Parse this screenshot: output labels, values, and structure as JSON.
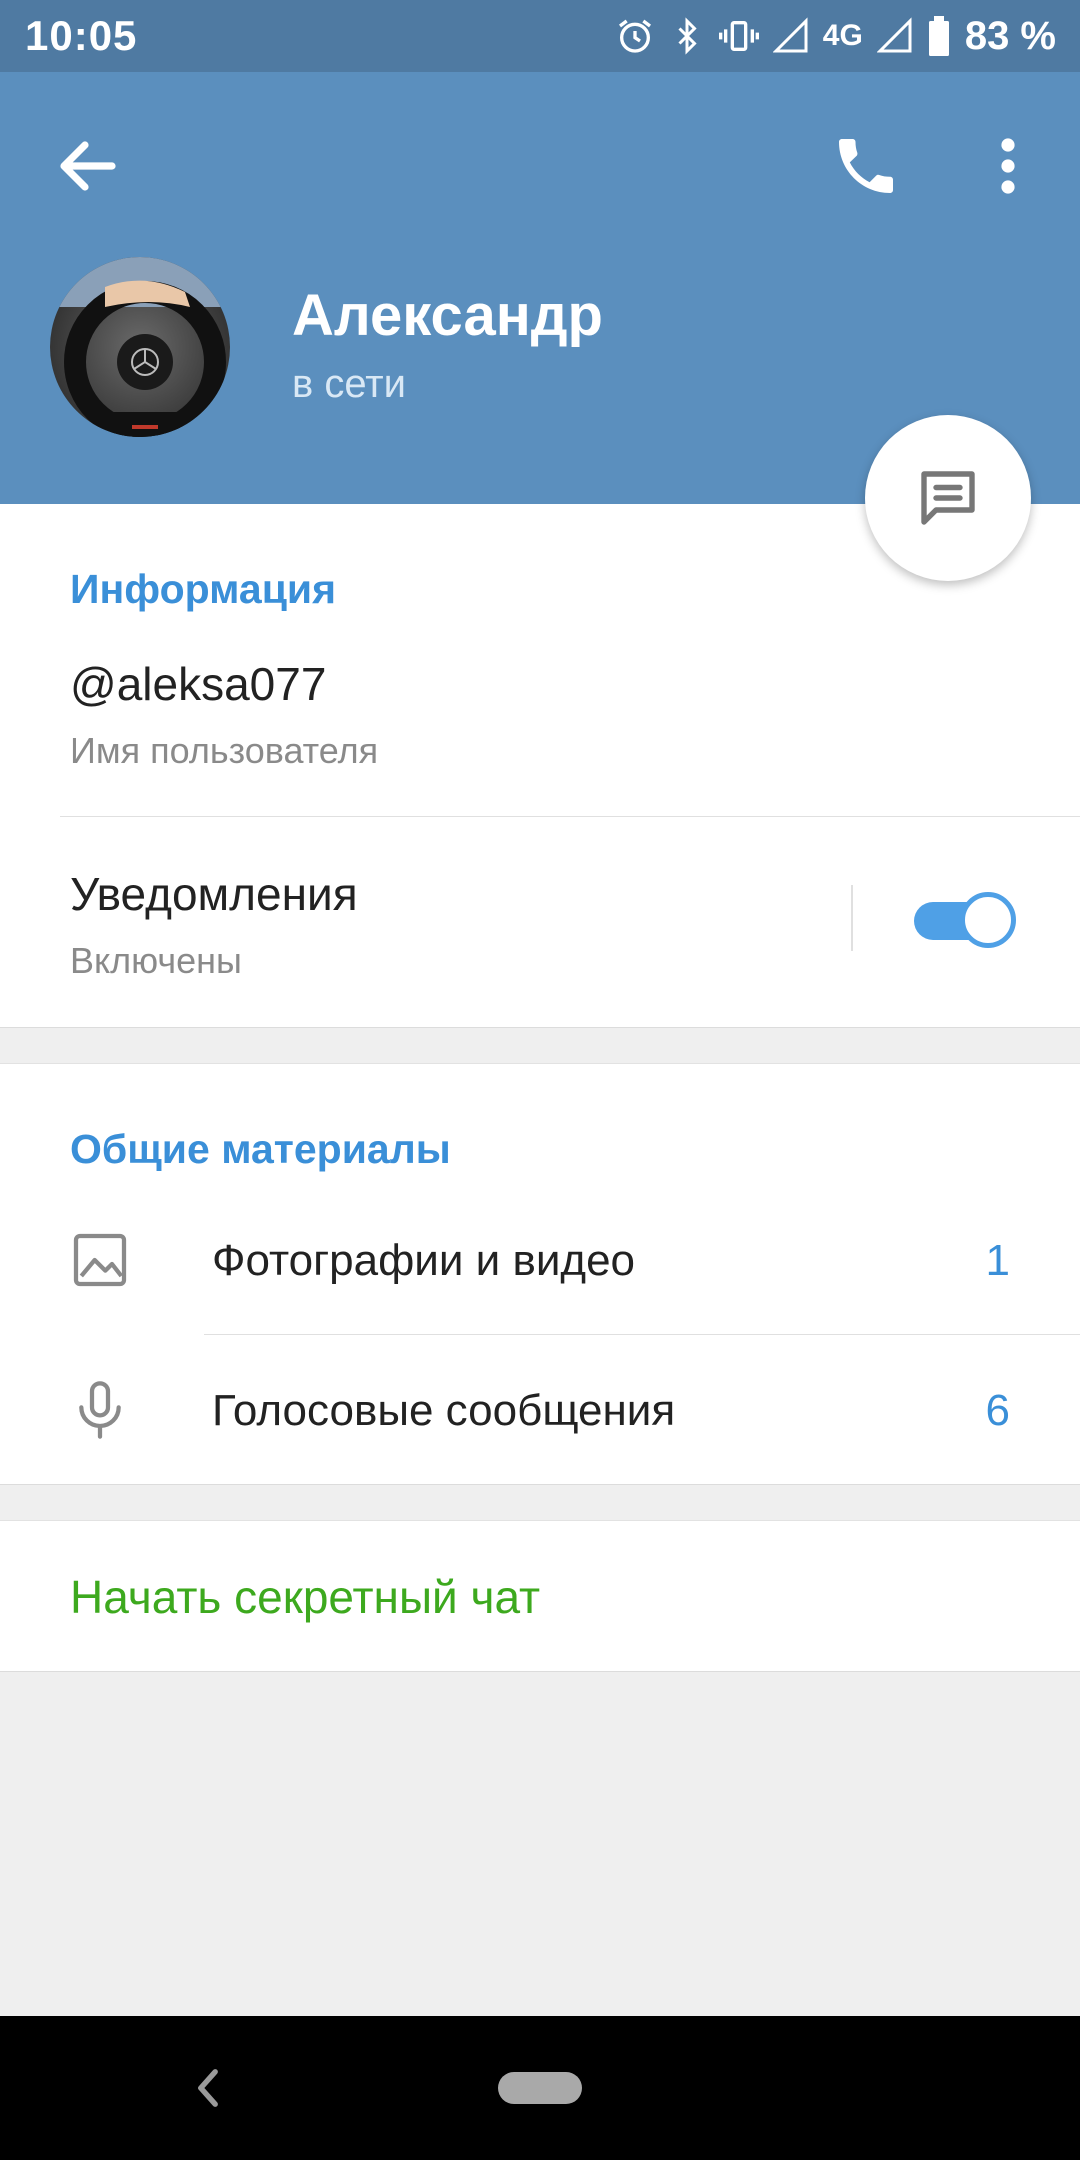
{
  "status_bar": {
    "time": "10:05",
    "network": "4G",
    "battery": "83 %"
  },
  "header": {
    "name": "Александр",
    "status": "в сети"
  },
  "info": {
    "section_title": "Информация",
    "username": "@aleksa077",
    "username_label": "Имя пользователя",
    "notifications_title": "Уведомления",
    "notifications_state": "Включены",
    "notifications_enabled": true
  },
  "shared": {
    "section_title": "Общие материалы",
    "items": [
      {
        "icon": "image-icon",
        "label": "Фотографии и видео",
        "count": "1"
      },
      {
        "icon": "microphone-icon",
        "label": "Голосовые сообщения",
        "count": "6"
      }
    ]
  },
  "secret_chat": {
    "label": "Начать секретный чат"
  },
  "colors": {
    "header": "#5b8fbe",
    "status_bar": "#4f7aa2",
    "accent": "#3a8fd8",
    "secret": "#3da91e"
  }
}
